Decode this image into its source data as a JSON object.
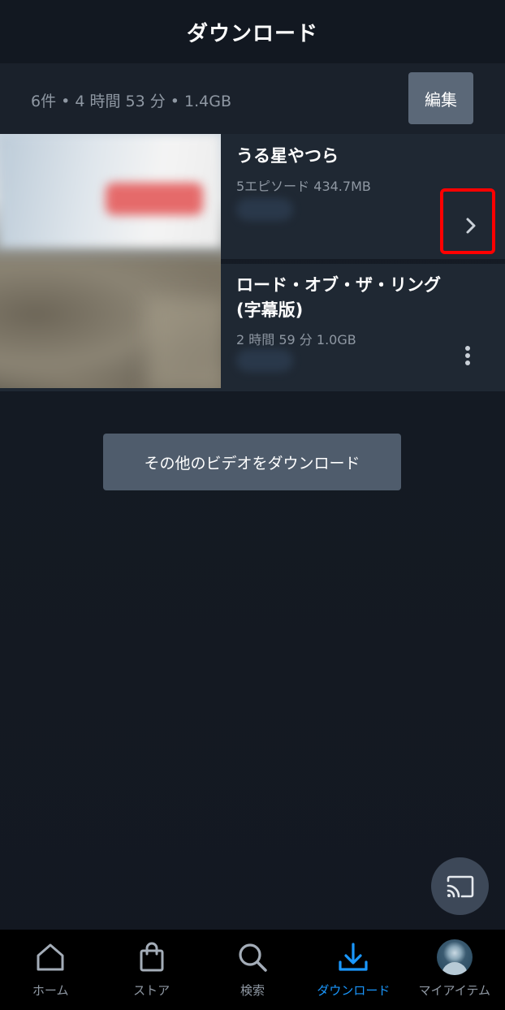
{
  "header": {
    "title": "ダウンロード"
  },
  "summary": {
    "info": "6件 • 4 時間 53 分 • 1.4GB",
    "edit_label": "編集"
  },
  "downloads": [
    {
      "title": "うる星やつら",
      "meta": "5エピソード 434.7MB",
      "action_icon": "chevron-right-icon"
    },
    {
      "title_line1": "ロード・オブ・ザ・リング",
      "title_line2": "(字幕版)",
      "meta": "2 時間 59 分   1.0GB",
      "action_icon": "more-vertical-icon"
    }
  ],
  "more_button": {
    "label": "その他のビデオをダウンロード"
  },
  "cast": {
    "icon": "cast-icon"
  },
  "bottom_nav": {
    "items": [
      {
        "label": "ホーム",
        "icon": "home-icon"
      },
      {
        "label": "ストア",
        "icon": "shopping-bag-icon"
      },
      {
        "label": "検索",
        "icon": "search-icon"
      },
      {
        "label": "ダウンロード",
        "icon": "download-icon",
        "active": true
      },
      {
        "label": "マイアイテム",
        "icon": "avatar"
      }
    ]
  },
  "colors": {
    "accent": "#1a98ff",
    "highlight": "#ff0000",
    "background": "#141a24",
    "card": "#1f2833"
  }
}
